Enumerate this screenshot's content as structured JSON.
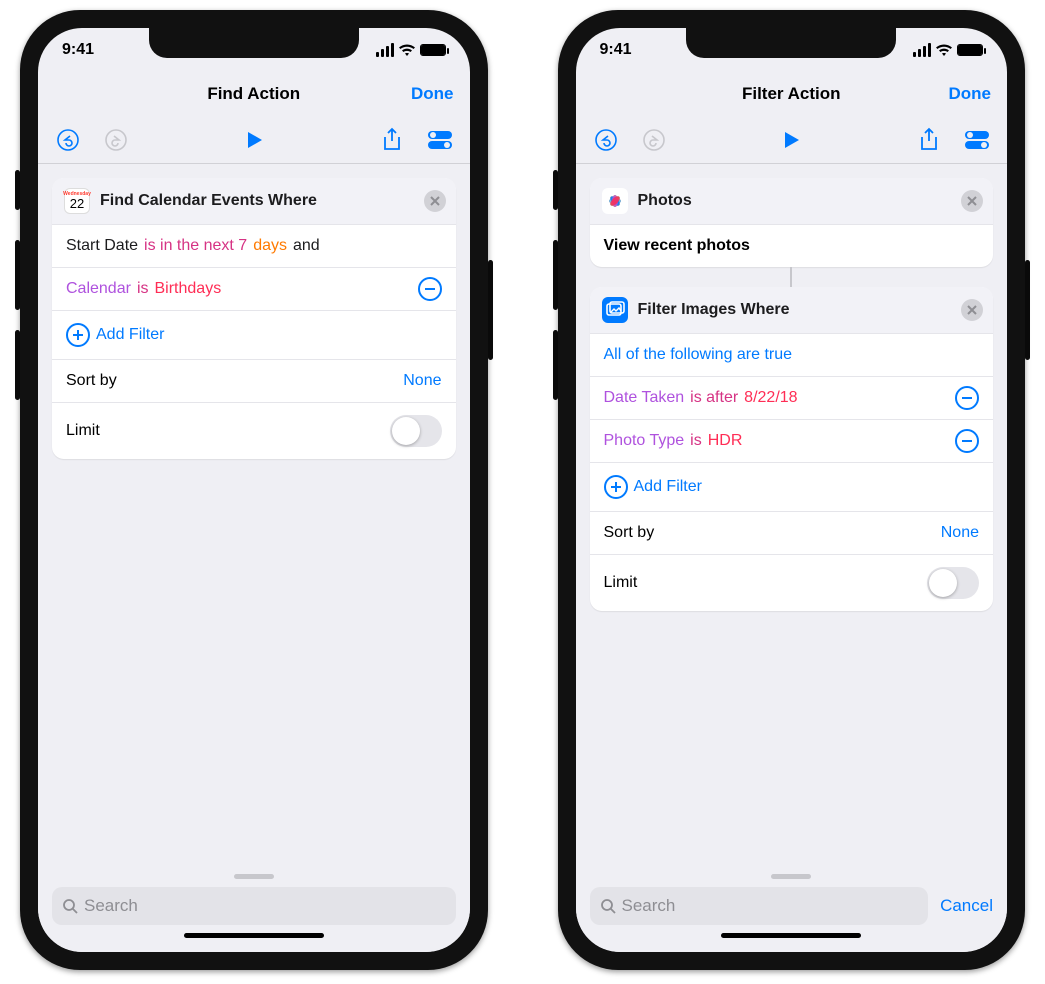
{
  "status": {
    "time": "9:41"
  },
  "phones": {
    "left": {
      "nav": {
        "title": "Find Action",
        "done": "Done"
      },
      "card1": {
        "title": "Find Calendar Events Where",
        "row1": {
          "black1": "Start Date",
          "pink": "is in the next 7",
          "orange": "days",
          "black2": "and"
        },
        "row2": {
          "purple": "Calendar",
          "pink": "is",
          "red": "Birthdays"
        },
        "addFilter": "Add Filter",
        "sortLabel": "Sort by",
        "sortValue": "None",
        "limitLabel": "Limit"
      },
      "search": {
        "placeholder": "Search"
      }
    },
    "right": {
      "nav": {
        "title": "Filter Action",
        "done": "Done"
      },
      "photosCard": {
        "title": "Photos",
        "subtitle": "View recent photos"
      },
      "filterCard": {
        "title": "Filter Images Where",
        "cond": "All of the following are true",
        "row1": {
          "purple": "Date Taken",
          "pink": "is after",
          "red": "8/22/18"
        },
        "row2": {
          "purple": "Photo Type",
          "pink": "is",
          "red": "HDR"
        },
        "addFilter": "Add Filter",
        "sortLabel": "Sort by",
        "sortValue": "None",
        "limitLabel": "Limit"
      },
      "search": {
        "placeholder": "Search",
        "cancel": "Cancel"
      }
    }
  }
}
